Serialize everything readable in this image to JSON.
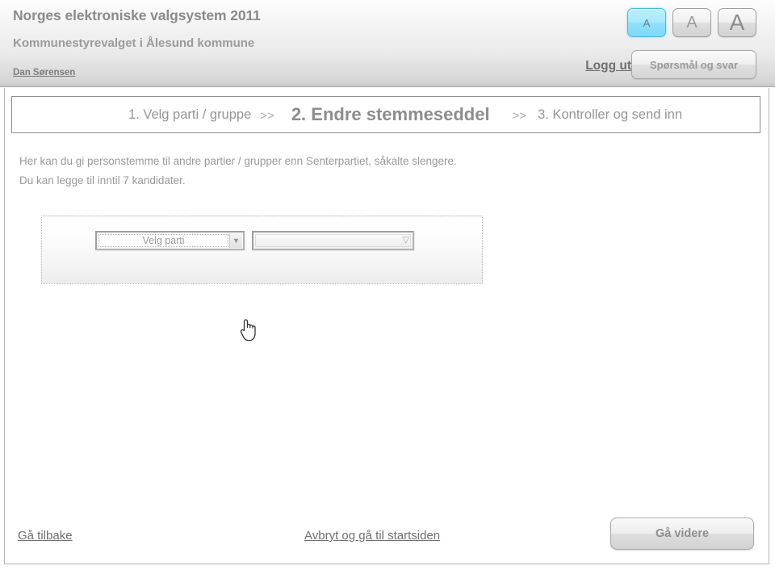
{
  "header": {
    "title": "Norges elektroniske valgsystem 2011",
    "subtitle": "Kommunestyrevalget i Ålesund kommune",
    "user_link": "Dan Sørensen",
    "logout_label": "Logg ut",
    "qa_button_label": "Spørsmål og svar",
    "font_sizes": [
      {
        "glyph": "A",
        "name": "font-size-small",
        "selected": true
      },
      {
        "glyph": "A",
        "name": "font-size-medium",
        "selected": false
      },
      {
        "glyph": "A",
        "name": "font-size-large",
        "selected": false
      }
    ],
    "accent_color": "#8fe0f8"
  },
  "steps": {
    "step1": "1. Velg parti / gruppe",
    "separator1": ">>",
    "step2": "2. Endre stemmeseddel",
    "separator2": ">>",
    "step3": "3. Kontroller og send inn",
    "current": "step2"
  },
  "intro": {
    "line1": "Her kan du gi personstemme til andre partier / grupper enn Senterpartiet, såkalte slengere.",
    "line2": "Du kan legge til inntil 7 kandidater."
  },
  "party_panel": {
    "party_select": {
      "selected_value": "Velg parti",
      "arrow_glyph": "▼"
    },
    "candidate_select": {
      "selected_value": "",
      "arrow_glyph": "▽"
    }
  },
  "footer": {
    "back_link": "Gå tilbake",
    "cancel_link": "Avbryt og gå til startsiden",
    "next_button": "Gå videre"
  }
}
